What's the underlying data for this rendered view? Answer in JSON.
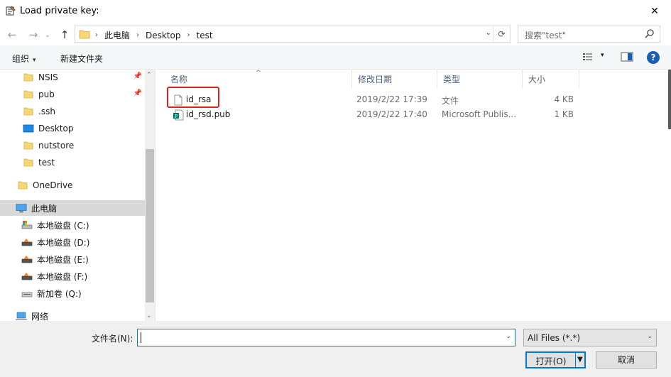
{
  "window": {
    "title": "Load private key:",
    "close_glyph": "✕"
  },
  "nav": {
    "back_glyph": "←",
    "forward_glyph": "→",
    "recent_glyph": "⌄",
    "up_glyph": "↑"
  },
  "address": {
    "crumbs": [
      "此电脑",
      "Desktop",
      "test"
    ],
    "separator": "›",
    "dropdown_glyph": "⌄",
    "refresh_glyph": "⟳"
  },
  "search": {
    "placeholder": "搜索\"test\""
  },
  "toolbar": {
    "organize_label": "组织",
    "new_folder_label": "新建文件夹",
    "caret": "▾",
    "help_label": "?"
  },
  "sidebar": {
    "items": [
      {
        "label": "NSIS",
        "icon": "folder-icon",
        "pinned": true
      },
      {
        "label": "pub",
        "icon": "folder-icon",
        "pinned": true
      },
      {
        "label": ".ssh",
        "icon": "folder-icon",
        "pinned": false
      },
      {
        "label": "Desktop",
        "icon": "desktop-icon",
        "pinned": false
      },
      {
        "label": "nutstore",
        "icon": "folder-icon",
        "pinned": false
      },
      {
        "label": "test",
        "icon": "folder-icon",
        "pinned": false
      },
      {
        "label": "OneDrive",
        "icon": "folder-icon",
        "pinned": false
      },
      {
        "label": "此电脑",
        "icon": "computer-icon",
        "pinned": false
      },
      {
        "label": "本地磁盘 (C:)",
        "icon": "drive-icon",
        "pinned": false
      },
      {
        "label": "本地磁盘 (D:)",
        "icon": "drive-icon",
        "pinned": false
      },
      {
        "label": "本地磁盘 (E:)",
        "icon": "drive-icon",
        "pinned": false
      },
      {
        "label": "本地磁盘 (F:)",
        "icon": "drive-icon",
        "pinned": false
      },
      {
        "label": "新加卷 (Q:)",
        "icon": "drive-icon",
        "pinned": false
      },
      {
        "label": "网络",
        "icon": "network-icon",
        "pinned": false
      }
    ],
    "scroll_up": "⌃",
    "scroll_down": "⌄"
  },
  "columns": {
    "name": "名称",
    "modified": "修改日期",
    "type": "类型",
    "size": "大小",
    "sort_glyph": "^"
  },
  "files": [
    {
      "name": "id_rsa",
      "modified": "2019/2/22 17:39",
      "type": "文件",
      "size": "4 KB",
      "icon": "file-icon"
    },
    {
      "name": "id_rsd.pub",
      "modified": "2019/2/22 17:40",
      "type": "Microsoft Publis...",
      "size": "1 KB",
      "icon": "publisher-file-icon"
    }
  ],
  "footer": {
    "filename_label": "文件名(N):",
    "filename_value": "",
    "filetype_value": "All Files (*.*)",
    "dropdown_glyph": "⌄",
    "open_label": "打开(O)",
    "open_arrow": "▼",
    "cancel_label": "取消"
  }
}
